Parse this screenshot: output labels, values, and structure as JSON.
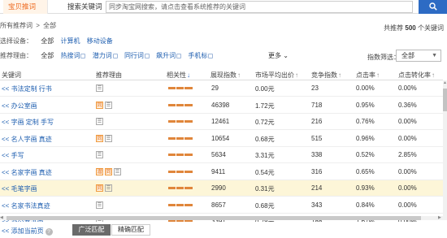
{
  "tabs": {
    "active": "宝贝推词",
    "normal": "搜索关键词"
  },
  "search": {
    "placeholder": "同步淘宝网搜索，请点击查看系统推荐的关键词"
  },
  "breadcrumb": {
    "root": "所有推荐词",
    "sep": ">",
    "current": "全部"
  },
  "total": {
    "prefix": "共推荐",
    "count": "500",
    "suffix": "个关键词"
  },
  "device": {
    "label": "选择设备：",
    "options": [
      "全部",
      "计算机",
      "移动设备"
    ]
  },
  "reason": {
    "label": "推荐理由：",
    "options": [
      "全部",
      "热搜词",
      "潜力词",
      "同行词",
      "飙升词",
      "手机标"
    ]
  },
  "more": "更多",
  "index_filter": {
    "label": "指数筛选：",
    "value": "全部"
  },
  "columns": [
    "关键词",
    "推荐理由",
    "相关性",
    "展现指数",
    "市场平均出价",
    "竞争指数",
    "点击率",
    "点击转化率"
  ],
  "rows": [
    {
      "kw": "<< 书法定制 行书",
      "tags": [
        "flag"
      ],
      "impr": "29",
      "bid": "0.00元",
      "comp": "23",
      "ctr": "0.00%",
      "cvr": "0.00%"
    },
    {
      "kw": "<< 办公室画",
      "tags": [
        "同",
        "flag"
      ],
      "impr": "46398",
      "bid": "1.72元",
      "comp": "718",
      "ctr": "0.95%",
      "cvr": "0.36%"
    },
    {
      "kw": "<< 字画 定制 手写",
      "tags": [
        "flag"
      ],
      "impr": "12461",
      "bid": "0.72元",
      "comp": "216",
      "ctr": "0.76%",
      "cvr": "0.00%"
    },
    {
      "kw": "<< 名人字画 真迹",
      "tags": [
        "同",
        "flag"
      ],
      "impr": "10654",
      "bid": "0.68元",
      "comp": "515",
      "ctr": "0.96%",
      "cvr": "0.00%"
    },
    {
      "kw": "<< 手写",
      "tags": [
        "flag"
      ],
      "impr": "5634",
      "bid": "3.31元",
      "comp": "338",
      "ctr": "0.52%",
      "cvr": "2.85%"
    },
    {
      "kw": "<< 名家字画 真迹",
      "tags": [
        "潜",
        "同",
        "flag"
      ],
      "impr": "9411",
      "bid": "0.54元",
      "comp": "316",
      "ctr": "0.65%",
      "cvr": "0.00%"
    },
    {
      "kw": "<< 毛笔字画",
      "tags": [
        "同",
        "flag"
      ],
      "impr": "2990",
      "bid": "0.31元",
      "comp": "214",
      "ctr": "0.93%",
      "cvr": "0.00%"
    },
    {
      "kw": "<< 名家书法真迹",
      "tags": [
        "flag"
      ],
      "impr": "8657",
      "bid": "0.68元",
      "comp": "343",
      "ctr": "0.84%",
      "cvr": "0.00%"
    },
    {
      "kw": "<< 办公室书画",
      "tags": [
        "flag"
      ],
      "impr": "3391",
      "bid": "0.78元",
      "comp": "188",
      "ctr": "1.67%",
      "cvr": "0.00%"
    }
  ],
  "bottom": {
    "add_page": "<< 添加当前页",
    "broad": "广泛匹配",
    "exact": "精确匹配",
    "help": "?"
  }
}
